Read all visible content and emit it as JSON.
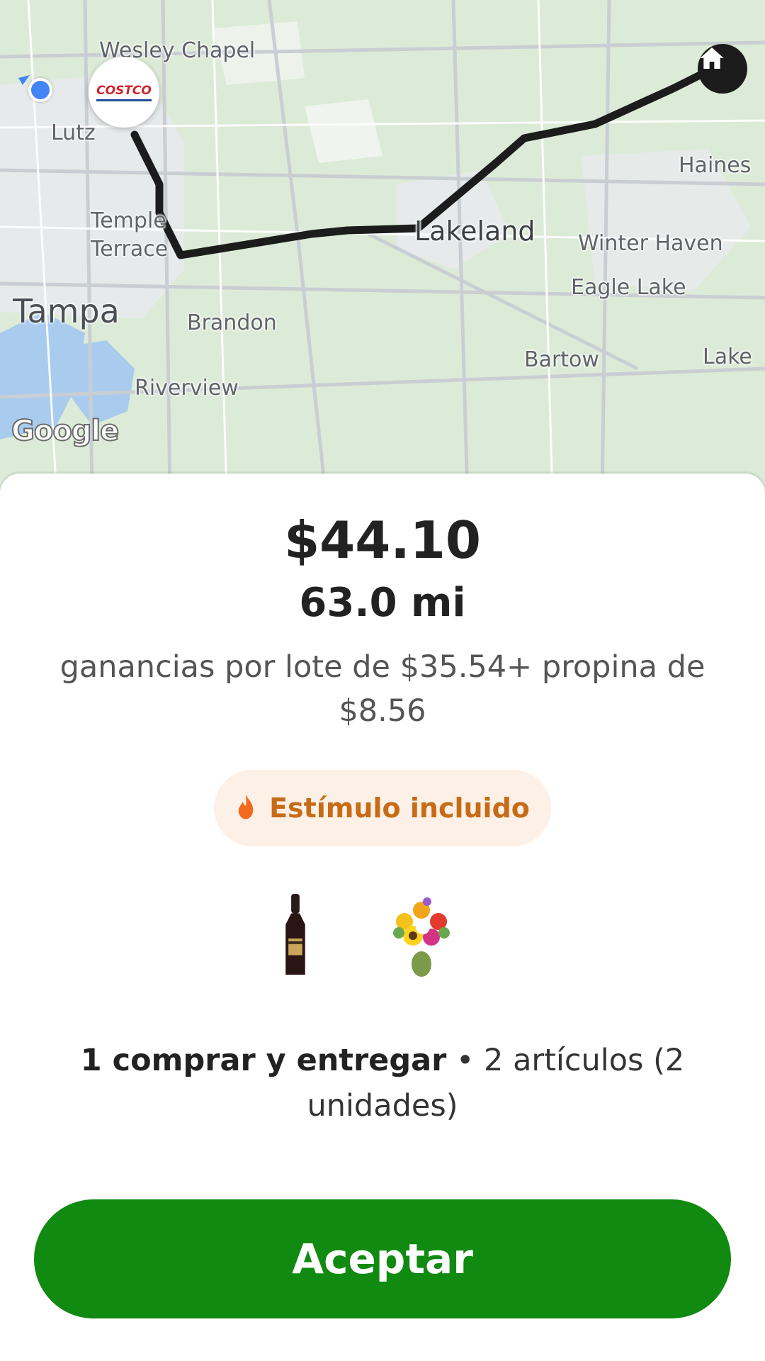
{
  "map": {
    "labels": {
      "wesley_chapel": "Wesley Chapel",
      "lutz": "Lutz",
      "temple_terrace": "Temple Terrace",
      "tampa": "Tampa",
      "brandon": "Brandon",
      "riverview": "Riverview",
      "lakeland": "Lakeland",
      "winter_haven": "Winter Haven",
      "eagle_lake": "Eagle Lake",
      "bartow": "Bartow",
      "haines": "Haines",
      "lake": "Lake"
    },
    "store_logo": "COSTCO",
    "attribution": "Google",
    "icons": {
      "pickup": "costco-store-icon",
      "dropoff": "home-icon",
      "current": "location-dot-icon"
    }
  },
  "offer": {
    "price": "$44.10",
    "distance": "63.0 mi",
    "earnings_line": "ganancias por lote de $35.54+ propina de $8.56",
    "incentive": "Estímulo incluido",
    "incentive_icon": "fire-icon",
    "items": [
      {
        "name": "wine-bottle",
        "icon": "wine-bottle-image"
      },
      {
        "name": "flower-bouquet",
        "icon": "flower-bouquet-image"
      }
    ],
    "summary_bold": "1 comprar y entregar",
    "summary_rest": "• 2 artículos (2 unidades)",
    "accept_label": "Aceptar"
  },
  "colors": {
    "accept": "#108a10",
    "incentive_text": "#c76b17",
    "incentive_bg": "#fdf0e6",
    "route": "#1c1c1c"
  }
}
